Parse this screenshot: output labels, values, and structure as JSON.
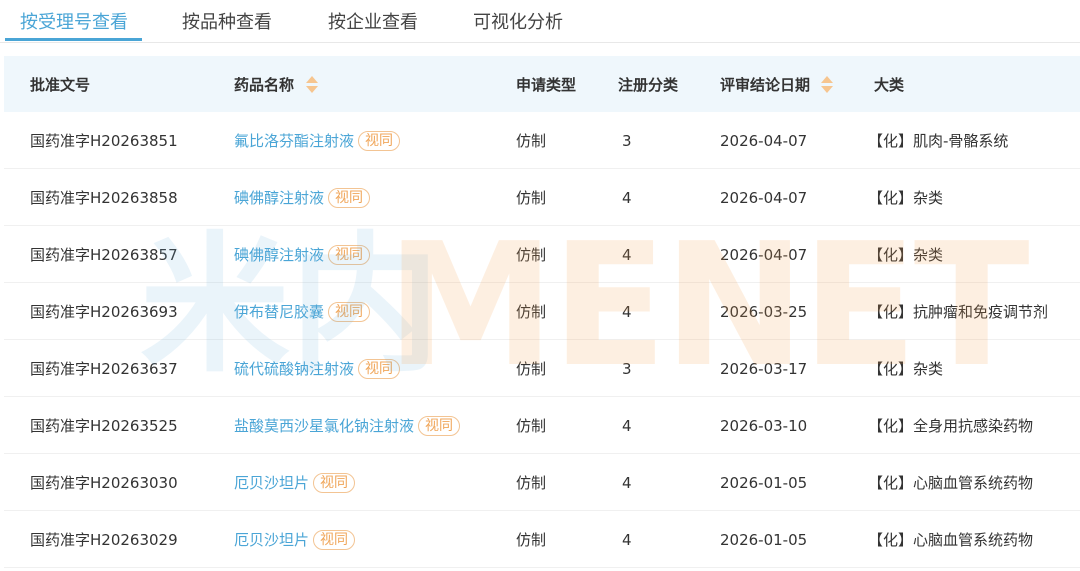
{
  "tabs": [
    {
      "label": "按受理号查看",
      "active": true
    },
    {
      "label": "按品种查看",
      "active": false
    },
    {
      "label": "按企业查看",
      "active": false
    },
    {
      "label": "可视化分析",
      "active": false
    }
  ],
  "table": {
    "columns": [
      "批准文号",
      "药品名称",
      "申请类型",
      "注册分类",
      "评审结论日期",
      "大类"
    ],
    "rows": [
      {
        "approval": "国药准字H20263851",
        "drug": "氟比洛芬酯注射液",
        "tag": "视同",
        "type": "仿制",
        "class": "3",
        "date": "2026-04-07",
        "category": "【化】肌肉-骨骼系统"
      },
      {
        "approval": "国药准字H20263858",
        "drug": "碘佛醇注射液",
        "tag": "视同",
        "type": "仿制",
        "class": "4",
        "date": "2026-04-07",
        "category": "【化】杂类"
      },
      {
        "approval": "国药准字H20263857",
        "drug": "碘佛醇注射液",
        "tag": "视同",
        "type": "仿制",
        "class": "4",
        "date": "2026-04-07",
        "category": "【化】杂类"
      },
      {
        "approval": "国药准字H20263693",
        "drug": "伊布替尼胶囊",
        "tag": "视同",
        "type": "仿制",
        "class": "4",
        "date": "2026-03-25",
        "category": "【化】抗肿瘤和免疫调节剂"
      },
      {
        "approval": "国药准字H20263637",
        "drug": "硫代硫酸钠注射液",
        "tag": "视同",
        "type": "仿制",
        "class": "3",
        "date": "2026-03-17",
        "category": "【化】杂类"
      },
      {
        "approval": "国药准字H20263525",
        "drug": "盐酸莫西沙星氯化钠注射液",
        "tag": "视同",
        "type": "仿制",
        "class": "4",
        "date": "2026-03-10",
        "category": "【化】全身用抗感染药物"
      },
      {
        "approval": "国药准字H20263030",
        "drug": "厄贝沙坦片",
        "tag": "视同",
        "type": "仿制",
        "class": "4",
        "date": "2026-01-05",
        "category": "【化】心脑血管系统药物"
      },
      {
        "approval": "国药准字H20263029",
        "drug": "厄贝沙坦片",
        "tag": "视同",
        "type": "仿制",
        "class": "4",
        "date": "2026-01-05",
        "category": "【化】心脑血管系统药物"
      }
    ]
  },
  "watermark": {
    "cn": "米内",
    "en": "MENET"
  }
}
